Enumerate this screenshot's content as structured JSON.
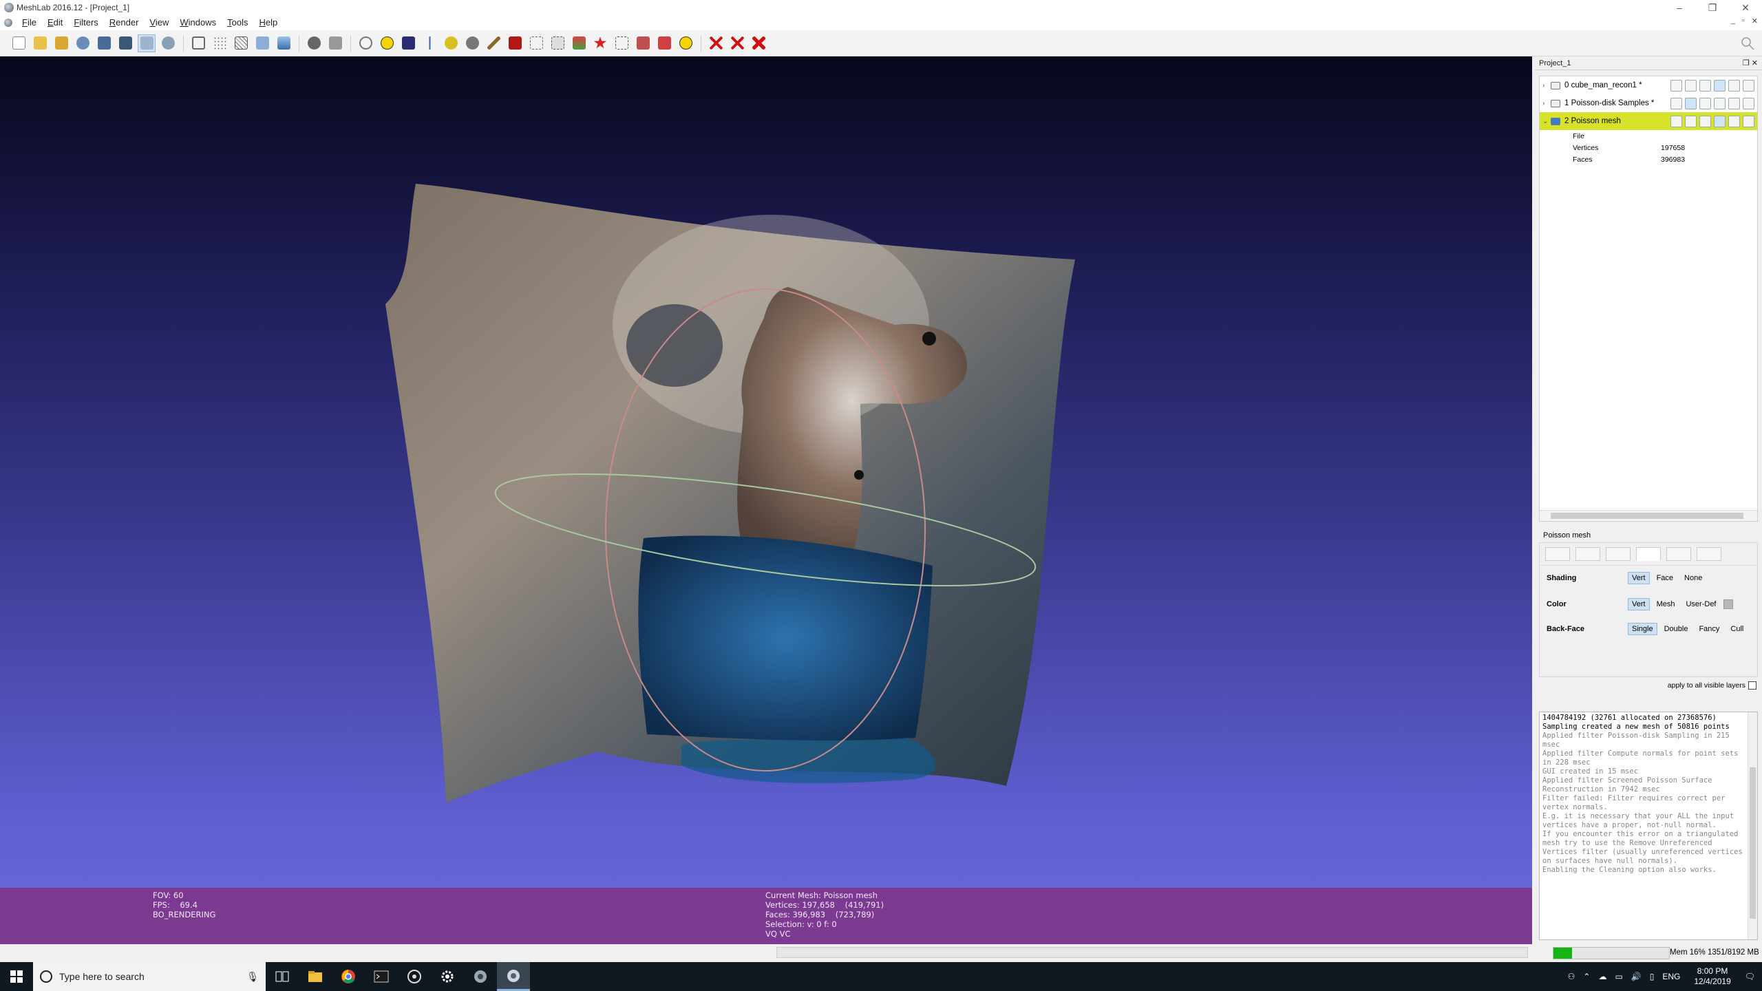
{
  "window": {
    "title": "MeshLab 2016.12 - [Project_1]",
    "controls": [
      "–",
      "❐",
      "✕"
    ]
  },
  "menu": {
    "items": [
      "File",
      "Edit",
      "Filters",
      "Render",
      "View",
      "Windows",
      "Tools",
      "Help"
    ],
    "mdi_controls": [
      "_",
      "▫",
      "✕"
    ]
  },
  "toolbar": {
    "groups": [
      [
        "new-project",
        "open-project",
        "open-mesh",
        "reload",
        "save-mesh",
        "snapshot",
        "layers",
        "raster"
      ],
      [
        "bbox-render",
        "points-render",
        "wireframe-render",
        "flat-render",
        "smooth-render",
        "texture-render"
      ],
      [
        "light",
        "trackball",
        "center",
        "annotation",
        "measure",
        "align",
        "select-vertex",
        "paint",
        "raster-edit",
        "z-painting",
        "manipulator",
        "pick-points",
        "isoparametrization",
        "select-connected",
        "select-faces",
        "info"
      ],
      [
        "delete-faces",
        "delete-vertices",
        "delete-selected"
      ]
    ]
  },
  "viewport": {
    "info_left": [
      "FOV: 60",
      "FPS:    69.4",
      "BO_RENDERING"
    ],
    "info_center": [
      "Current Mesh: Poisson mesh",
      "Vertices: 197,658    (419,791)",
      "Faces: 396,983    (723,789)",
      "Selection: v: 0 f: 0",
      "VQ VC"
    ]
  },
  "layer_panel": {
    "title": "Project_1",
    "layers": [
      {
        "index": "0",
        "name": "cube_man_recon1 *",
        "selected": false
      },
      {
        "index": "1",
        "name": "Poisson-disk Samples *",
        "selected": false
      },
      {
        "index": "2",
        "name": "Poisson mesh",
        "selected": true
      }
    ],
    "details": [
      {
        "key": "File",
        "value": ""
      },
      {
        "key": "Vertices",
        "value": "197658"
      },
      {
        "key": "Faces",
        "value": "396983"
      }
    ]
  },
  "decorator": {
    "title": "Poisson mesh",
    "shading": {
      "label": "Shading",
      "options": [
        "Vert",
        "Face",
        "None"
      ],
      "selected": "Vert"
    },
    "color": {
      "label": "Color",
      "options": [
        "Vert",
        "Mesh",
        "User-Def"
      ],
      "selected": "Vert"
    },
    "backface": {
      "label": "Back-Face",
      "options": [
        "Single",
        "Double",
        "Fancy",
        "Cull"
      ],
      "selected": "Single"
    },
    "apply_all": "apply to all visible layers"
  },
  "log": [
    {
      "text": "1404784192 (32761 allocated on 27368576)",
      "strong": true
    },
    {
      "text": "Sampling created a new mesh of 50816 points",
      "strong": true
    },
    {
      "text": "Applied filter Poisson-disk Sampling in 215 msec",
      "strong": false
    },
    {
      "text": "Applied filter Compute normals for point sets in 228 msec",
      "strong": false
    },
    {
      "text": "GUI created in 15 msec",
      "strong": false
    },
    {
      "text": "Applied filter Screened Poisson Surface Reconstruction in 7942 msec",
      "strong": false
    },
    {
      "text": "Filter failed: Filter requires correct per vertex normals.",
      "strong": false
    },
    {
      "text": "E.g. it is necessary that your ALL the input vertices have a proper, not-null normal.",
      "strong": false
    },
    {
      "text": "If you encounter this error on a triangulated mesh try to use the Remove Unreferenced Vertices filter (usually unreferenced vertices on surfaces have null normals).",
      "strong": false
    },
    {
      "text": "Enabling the Cleaning option also works.",
      "strong": false
    }
  ],
  "statusbar": {
    "memory": "Mem 16% 1351/8192 MB",
    "memory_fraction": 0.16
  },
  "taskbar": {
    "search_placeholder": "Type here to search",
    "apps": [
      "task-view",
      "file-explorer",
      "chrome",
      "terminal",
      "blender",
      "settings",
      "meshlab-alt",
      "meshlab"
    ],
    "language": "ENG",
    "time": "8:00 PM",
    "date": "12/4/2019"
  },
  "colors": {
    "selected_layer": "#d6e32a",
    "viewport_info_bg": "#803080",
    "memory_fill": "#12b512",
    "taskbar": "#101820"
  }
}
